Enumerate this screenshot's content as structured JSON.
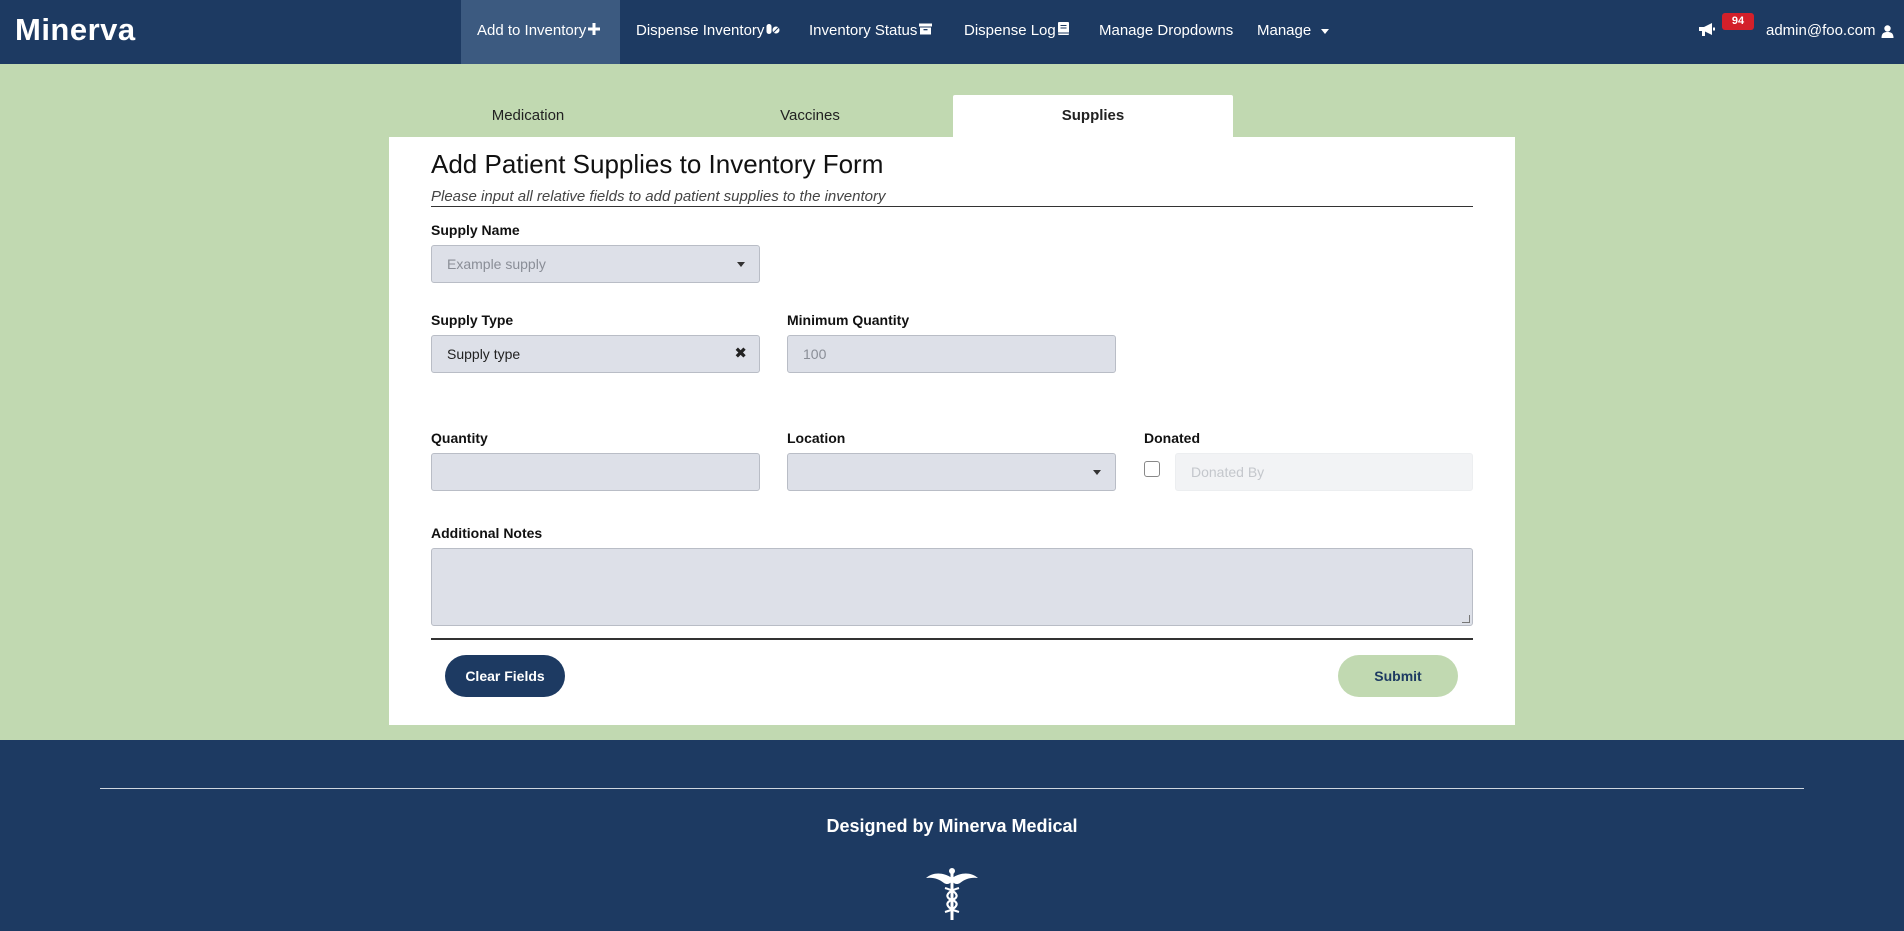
{
  "navbar": {
    "brand": "Minerva",
    "items": [
      {
        "label": "Add to Inventory",
        "icon": "plus-icon",
        "active": true
      },
      {
        "label": "Dispense Inventory",
        "icon": "pills-icon"
      },
      {
        "label": "Inventory Status",
        "icon": "archive-box-icon"
      },
      {
        "label": "Dispense Log",
        "icon": "book-icon"
      },
      {
        "label": "Manage Dropdowns"
      },
      {
        "label": "Manage",
        "icon": "caret-down-icon"
      }
    ],
    "notification_count": "94",
    "user_email": "admin@foo.com"
  },
  "tabs": [
    {
      "label": "Medication"
    },
    {
      "label": "Vaccines"
    },
    {
      "label": "Supplies",
      "active": true
    }
  ],
  "form": {
    "title": "Add Patient Supplies to Inventory Form",
    "subtitle": "Please input all relative fields to add patient supplies to the inventory",
    "supply_name": {
      "label": "Supply Name",
      "placeholder": "Example supply"
    },
    "supply_type": {
      "label": "Supply Type",
      "value": "Supply type"
    },
    "minimum_quantity": {
      "label": "Minimum Quantity",
      "placeholder": "100"
    },
    "quantity": {
      "label": "Quantity",
      "value": ""
    },
    "location": {
      "label": "Location",
      "value": ""
    },
    "donated": {
      "label": "Donated",
      "checked": false,
      "donated_by_placeholder": "Donated By"
    },
    "additional_notes": {
      "label": "Additional Notes",
      "value": ""
    },
    "clear_button": "Clear Fields",
    "submit_button": "Submit"
  },
  "footer": {
    "text": "Designed by Minerva Medical",
    "logo": "caduceus-icon"
  },
  "colors": {
    "navbar": "#1d3a62",
    "navbar_active": "#3c5a80",
    "background": "#c1d9b1",
    "badge": "#d3202a",
    "field": "#dde0e8"
  }
}
